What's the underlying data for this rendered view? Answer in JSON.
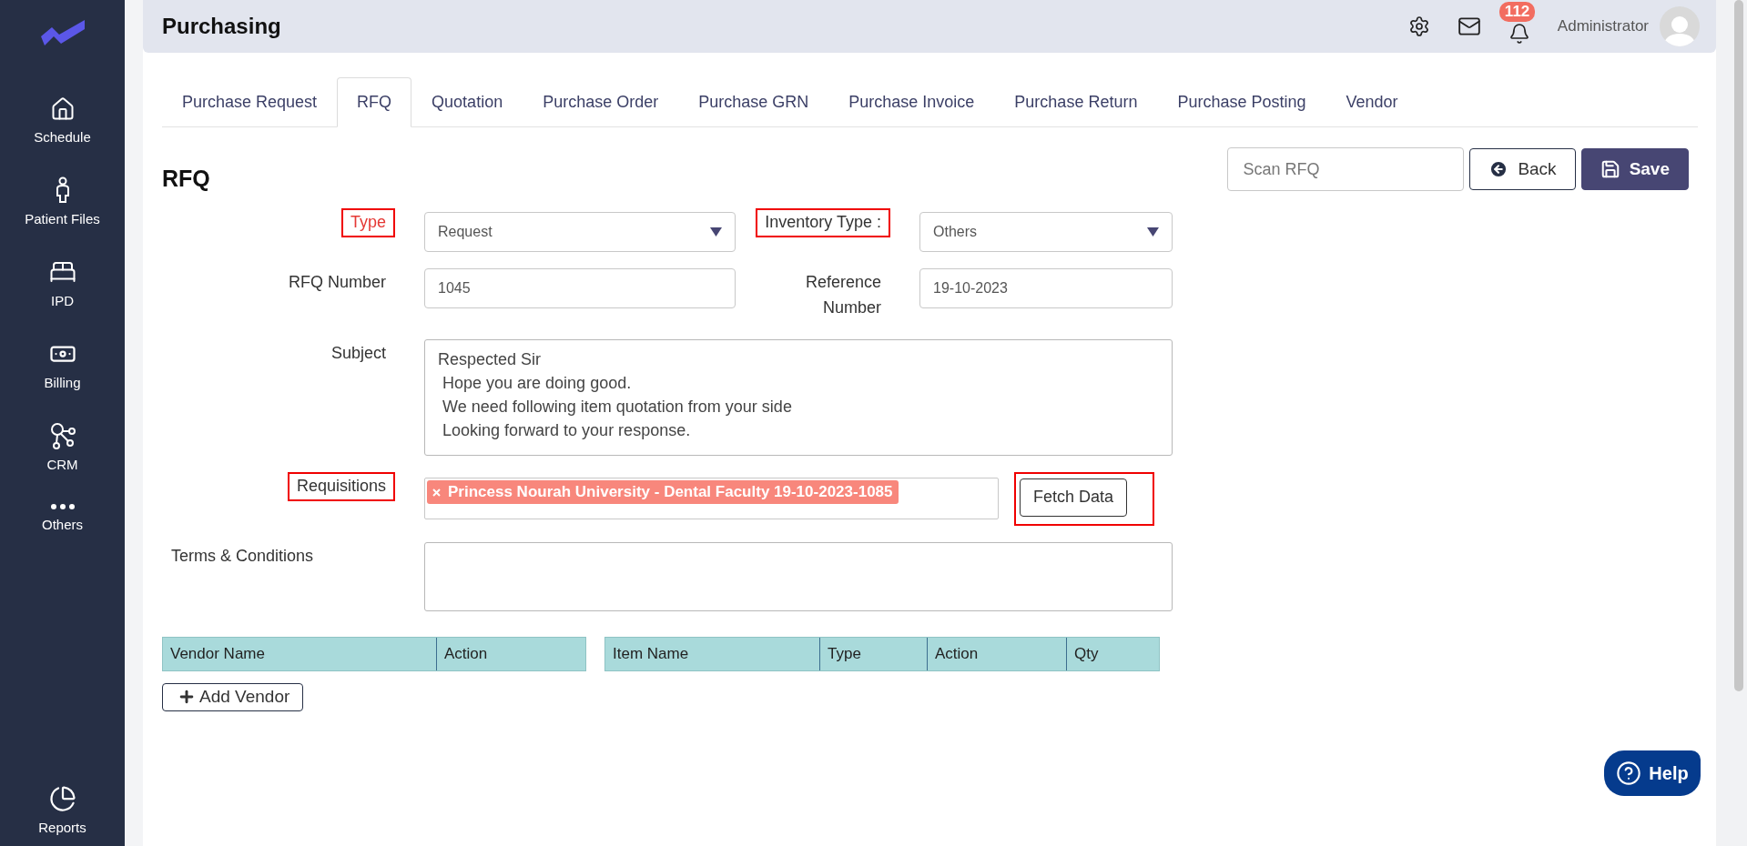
{
  "sidebar": {
    "items": [
      {
        "label": "Schedule"
      },
      {
        "label": "Patient Files"
      },
      {
        "label": "IPD"
      },
      {
        "label": "Billing"
      },
      {
        "label": "CRM"
      },
      {
        "label": "Others"
      }
    ],
    "footer_item": {
      "label": "Reports"
    }
  },
  "header": {
    "title": "Purchasing",
    "notification_count": "112",
    "user": "Administrator"
  },
  "tabs": [
    {
      "label": "Purchase Request",
      "selected": false
    },
    {
      "label": "RFQ",
      "selected": true
    },
    {
      "label": "Quotation",
      "selected": false
    },
    {
      "label": "Purchase Order",
      "selected": false
    },
    {
      "label": "Purchase GRN",
      "selected": false
    },
    {
      "label": "Purchase Invoice",
      "selected": false
    },
    {
      "label": "Purchase Return",
      "selected": false
    },
    {
      "label": "Purchase Posting",
      "selected": false
    },
    {
      "label": "Vendor",
      "selected": false
    }
  ],
  "page_title": "RFQ",
  "scan_field": {
    "placeholder": "Scan RFQ"
  },
  "actions": [
    {
      "label": "Back",
      "kind": "outline"
    },
    {
      "label": "Save",
      "kind": "primary"
    }
  ],
  "type_field": {
    "label": "Type",
    "value": "Request",
    "error": true,
    "highlighted": true
  },
  "inventory_type_field": {
    "label": "Inventory Type :",
    "value": "Others",
    "highlighted": true
  },
  "rfq_number_field": {
    "label": "RFQ Number",
    "value": "1045"
  },
  "reference_number_field": {
    "label": "Reference Number",
    "value": "19-10-2023"
  },
  "subject_field": {
    "label": "Subject",
    "lines": [
      "Respected Sir",
      " Hope you are doing good.",
      " We need following item quotation from your side",
      " Looking forward to your response."
    ]
  },
  "requisitions_field": {
    "label": "Requisitions",
    "highlighted": true,
    "tags": [
      "Princess Nourah University - Dental Faculty 19-10-2023-1085"
    ]
  },
  "fetch_button": {
    "label": "Fetch Data",
    "highlighted": true
  },
  "terms_field": {
    "label": "Terms & Conditions"
  },
  "vendor_table": {
    "columns": [
      "Vendor Name",
      "Action"
    ]
  },
  "items_table": {
    "columns": [
      "Item Name",
      "Type",
      "Action",
      "Qty"
    ]
  },
  "add_vendor_button": {
    "label": "Add Vendor"
  },
  "help_button": {
    "label": "Help"
  }
}
